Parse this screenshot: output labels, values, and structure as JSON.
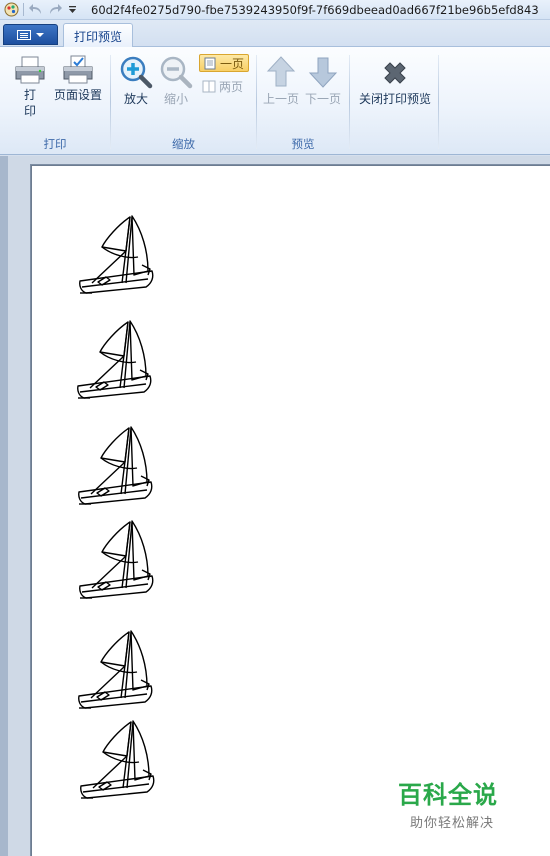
{
  "titlebar": {
    "title": "60d2f4fe0275d790-fbe7539243950f9f-7f669dbeead0ad667f21be96b5efd843",
    "icons": [
      "paint-app-icon",
      "undo-icon",
      "redo-icon",
      "customize-toolbar-icon"
    ]
  },
  "tabs": {
    "active": "打印预览"
  },
  "ribbon": {
    "print_group": {
      "label": "打印",
      "print_button": "打印",
      "page_setup_button": "页面设置"
    },
    "zoom_group": {
      "label": "缩放",
      "zoom_in_button": "放大",
      "zoom_out_button": "缩小",
      "one_page_button": "一页",
      "two_page_button": "两页"
    },
    "preview_group": {
      "label": "预览",
      "prev_page_button": "上一页",
      "next_page_button": "下一页"
    },
    "close_group": {
      "close_preview_button": "关闭打印预览"
    }
  },
  "page": {
    "boat_count": 6
  },
  "watermark": {
    "title": "百科全说",
    "subtitle": "助你轻松解决"
  },
  "colors": {
    "accent": "#1d4f9f",
    "ribbon_text": "#1e395b",
    "group_label": "#3e6aaa",
    "watermark": "#2aa84a"
  }
}
